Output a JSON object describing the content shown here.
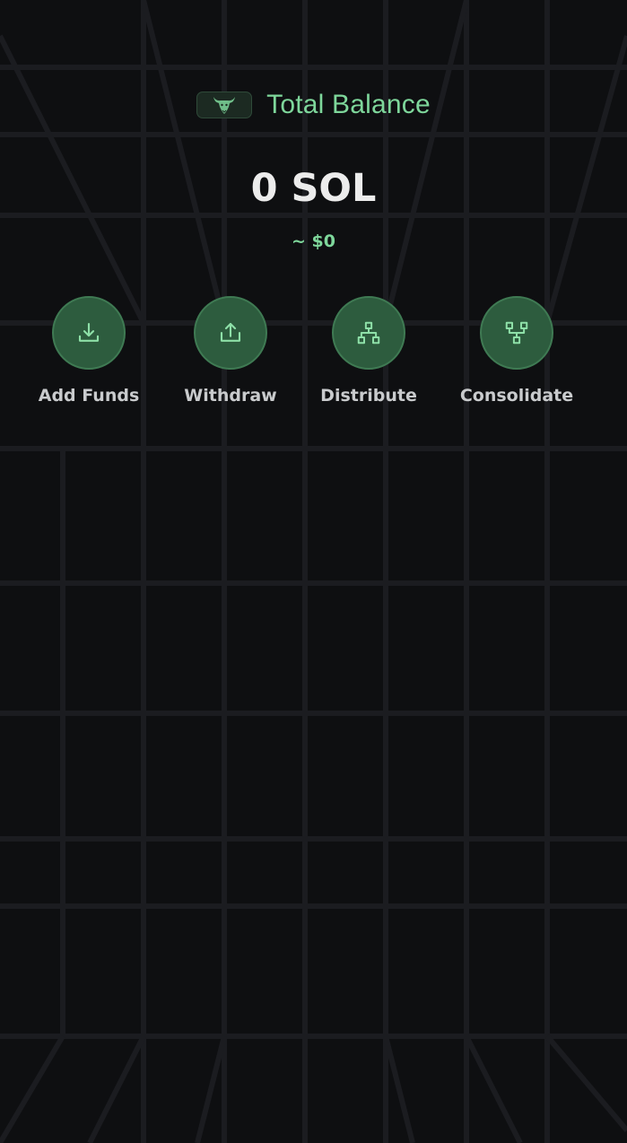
{
  "header": {
    "logo_icon": "bull-icon",
    "title": "Total Balance"
  },
  "balance": {
    "amount": "0 SOL",
    "usd": "~ $0"
  },
  "actions": [
    {
      "label": "Add Funds",
      "icon": "download-icon"
    },
    {
      "label": "Withdraw",
      "icon": "upload-icon"
    },
    {
      "label": "Distribute",
      "icon": "distribute-icon"
    },
    {
      "label": "Consolidate",
      "icon": "consolidate-icon"
    }
  ],
  "colors": {
    "background": "#0e0f11",
    "accent": "#7ed79b",
    "button_fill": "#2d5c3e",
    "grid_line": "#1a1b1e"
  }
}
